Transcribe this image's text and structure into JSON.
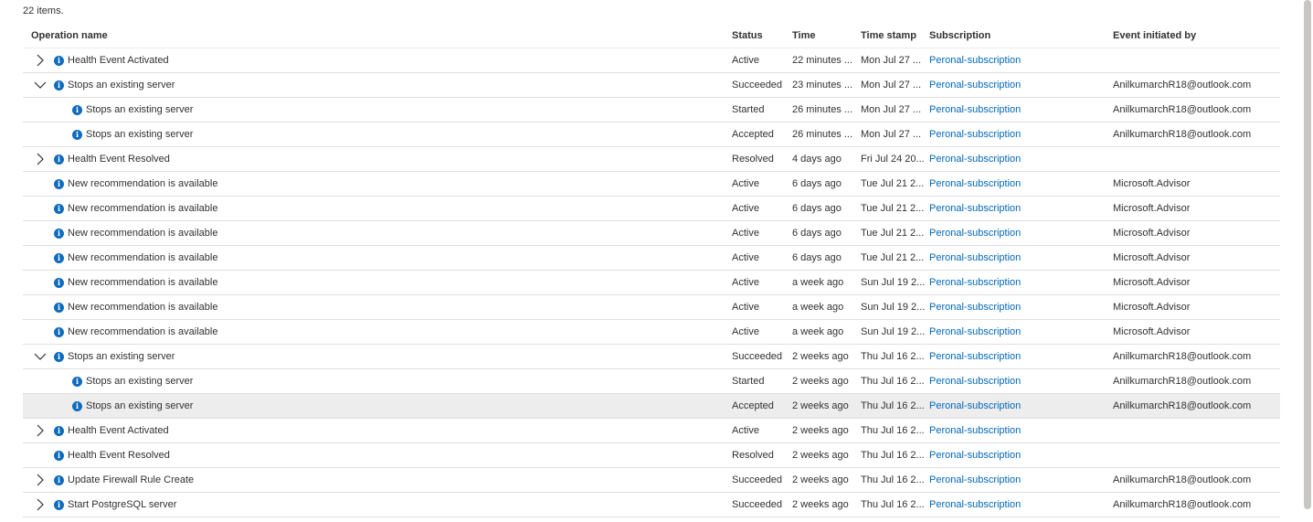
{
  "items_count": "22 items.",
  "columns": {
    "operation": "Operation name",
    "status": "Status",
    "time": "Time",
    "timestamp": "Time stamp",
    "subscription": "Subscription",
    "initiated_by": "Event initiated by"
  },
  "rows": [
    {
      "op": "Health Event Activated",
      "status": "Active",
      "time": "22 minutes ...",
      "stamp": "Mon Jul 27 ...",
      "sub": "Peronal-subscription",
      "by": "",
      "chevron": "right",
      "child": false,
      "selected": false
    },
    {
      "op": "Stops an existing server",
      "status": "Succeeded",
      "time": "23 minutes ...",
      "stamp": "Mon Jul 27 ...",
      "sub": "Peronal-subscription",
      "by": "AnilkumarchR18@outlook.com",
      "chevron": "down",
      "child": false,
      "selected": false
    },
    {
      "op": "Stops an existing server",
      "status": "Started",
      "time": "26 minutes ...",
      "stamp": "Mon Jul 27 ...",
      "sub": "Peronal-subscription",
      "by": "AnilkumarchR18@outlook.com",
      "chevron": "none",
      "child": true,
      "selected": false
    },
    {
      "op": "Stops an existing server",
      "status": "Accepted",
      "time": "26 minutes ...",
      "stamp": "Mon Jul 27 ...",
      "sub": "Peronal-subscription",
      "by": "AnilkumarchR18@outlook.com",
      "chevron": "none",
      "child": true,
      "selected": false
    },
    {
      "op": "Health Event Resolved",
      "status": "Resolved",
      "time": "4 days ago",
      "stamp": "Fri Jul 24 20...",
      "sub": "Peronal-subscription",
      "by": "",
      "chevron": "right",
      "child": false,
      "selected": false
    },
    {
      "op": "New recommendation is available",
      "status": "Active",
      "time": "6 days ago",
      "stamp": "Tue Jul 21 2...",
      "sub": "Peronal-subscription",
      "by": "Microsoft.Advisor",
      "chevron": "none",
      "child": false,
      "selected": false
    },
    {
      "op": "New recommendation is available",
      "status": "Active",
      "time": "6 days ago",
      "stamp": "Tue Jul 21 2...",
      "sub": "Peronal-subscription",
      "by": "Microsoft.Advisor",
      "chevron": "none",
      "child": false,
      "selected": false
    },
    {
      "op": "New recommendation is available",
      "status": "Active",
      "time": "6 days ago",
      "stamp": "Tue Jul 21 2...",
      "sub": "Peronal-subscription",
      "by": "Microsoft.Advisor",
      "chevron": "none",
      "child": false,
      "selected": false
    },
    {
      "op": "New recommendation is available",
      "status": "Active",
      "time": "6 days ago",
      "stamp": "Tue Jul 21 2...",
      "sub": "Peronal-subscription",
      "by": "Microsoft.Advisor",
      "chevron": "none",
      "child": false,
      "selected": false
    },
    {
      "op": "New recommendation is available",
      "status": "Active",
      "time": "a week ago",
      "stamp": "Sun Jul 19 2...",
      "sub": "Peronal-subscription",
      "by": "Microsoft.Advisor",
      "chevron": "none",
      "child": false,
      "selected": false
    },
    {
      "op": "New recommendation is available",
      "status": "Active",
      "time": "a week ago",
      "stamp": "Sun Jul 19 2...",
      "sub": "Peronal-subscription",
      "by": "Microsoft.Advisor",
      "chevron": "none",
      "child": false,
      "selected": false
    },
    {
      "op": "New recommendation is available",
      "status": "Active",
      "time": "a week ago",
      "stamp": "Sun Jul 19 2...",
      "sub": "Peronal-subscription",
      "by": "Microsoft.Advisor",
      "chevron": "none",
      "child": false,
      "selected": false
    },
    {
      "op": "Stops an existing server",
      "status": "Succeeded",
      "time": "2 weeks ago",
      "stamp": "Thu Jul 16 2...",
      "sub": "Peronal-subscription",
      "by": "AnilkumarchR18@outlook.com",
      "chevron": "down",
      "child": false,
      "selected": false
    },
    {
      "op": "Stops an existing server",
      "status": "Started",
      "time": "2 weeks ago",
      "stamp": "Thu Jul 16 2...",
      "sub": "Peronal-subscription",
      "by": "AnilkumarchR18@outlook.com",
      "chevron": "none",
      "child": true,
      "selected": false
    },
    {
      "op": "Stops an existing server",
      "status": "Accepted",
      "time": "2 weeks ago",
      "stamp": "Thu Jul 16 2...",
      "sub": "Peronal-subscription",
      "by": "AnilkumarchR18@outlook.com",
      "chevron": "none",
      "child": true,
      "selected": true
    },
    {
      "op": "Health Event Activated",
      "status": "Active",
      "time": "2 weeks ago",
      "stamp": "Thu Jul 16 2...",
      "sub": "Peronal-subscription",
      "by": "",
      "chevron": "right",
      "child": false,
      "selected": false
    },
    {
      "op": "Health Event Resolved",
      "status": "Resolved",
      "time": "2 weeks ago",
      "stamp": "Thu Jul 16 2...",
      "sub": "Peronal-subscription",
      "by": "",
      "chevron": "none",
      "child": false,
      "selected": false
    },
    {
      "op": "Update Firewall Rule Create",
      "status": "Succeeded",
      "time": "2 weeks ago",
      "stamp": "Thu Jul 16 2...",
      "sub": "Peronal-subscription",
      "by": "AnilkumarchR18@outlook.com",
      "chevron": "right",
      "child": false,
      "selected": false
    },
    {
      "op": "Start PostgreSQL server",
      "status": "Succeeded",
      "time": "2 weeks ago",
      "stamp": "Thu Jul 16 2...",
      "sub": "Peronal-subscription",
      "by": "AnilkumarchR18@outlook.com",
      "chevron": "right",
      "child": false,
      "selected": false
    }
  ],
  "colors": {
    "link": "#0067b8",
    "info_icon": "#0f6cbd",
    "selected_row": "#ededed",
    "divider": "#e1dfdd"
  },
  "icons": {
    "info": "info-icon",
    "expand": "chevron-right-icon",
    "collapse": "chevron-down-icon"
  }
}
